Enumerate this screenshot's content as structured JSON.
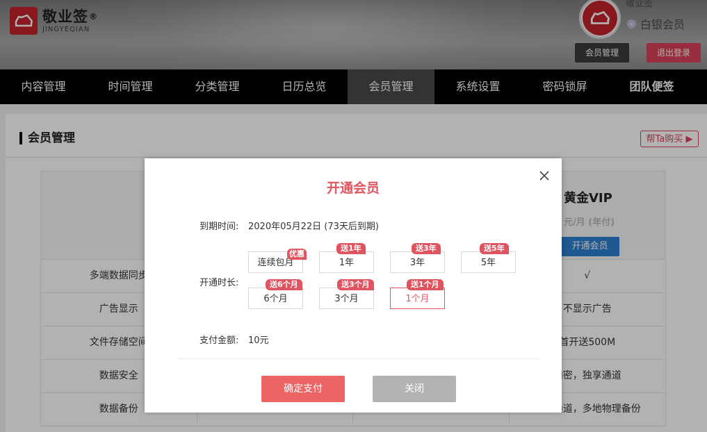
{
  "header": {
    "logo_title": "敬业签",
    "logo_registered": "®",
    "logo_subtitle": "JINGYEQIAN",
    "user_name": "敬业签",
    "member_level": "白银会员",
    "level_icon_text": "v",
    "member_manage_button": "会员管理",
    "logout_button": "退出登录",
    "colors": {
      "brand_red": "#c5212c",
      "logout_pink": "#d9415a"
    }
  },
  "nav": {
    "items": [
      {
        "label": "内容管理"
      },
      {
        "label": "时间管理"
      },
      {
        "label": "分类管理"
      },
      {
        "label": "日历总览"
      },
      {
        "label": "会员管理",
        "active": true
      },
      {
        "label": "系统设置"
      },
      {
        "label": "密码锁屏"
      },
      {
        "label": "团队便签"
      }
    ]
  },
  "page": {
    "section_title": "会员管理",
    "help_buy": "帮Ta购买",
    "plan": {
      "title": "黄金VIP",
      "price": "元/月 (年付)",
      "button": "开通会员"
    },
    "rows": [
      {
        "feature": "多端数据同步",
        "col2": "",
        "col3": "",
        "col4": "√"
      },
      {
        "feature": "广告显示",
        "col2": "",
        "col3": "",
        "col4": "不显示广告"
      },
      {
        "feature": "文件存储空间",
        "col2": "",
        "col3": "",
        "col4": "首开送500M"
      },
      {
        "feature": "数据安全",
        "col2": "",
        "col3": "",
        "col4": "加密，独享通道"
      },
      {
        "feature": "数据备份",
        "col2": "",
        "col3": "",
        "col4": "独享通道，多地物理备份"
      }
    ]
  },
  "modal": {
    "title": "开通会员",
    "close_icon": "close-icon",
    "expiry_label": "到期时间:",
    "expiry_value": "2020年05月22日 (73天后到期)",
    "duration_label": "开通时长:",
    "options": [
      {
        "label": "连续包月",
        "badge": "优惠"
      },
      {
        "label": "1年",
        "badge": "送1年"
      },
      {
        "label": "3年",
        "badge": "送3年"
      },
      {
        "label": "5年",
        "badge": "送5年"
      },
      {
        "label": "6个月",
        "badge": "送6个月"
      },
      {
        "label": "3个月",
        "badge": "送3个月"
      },
      {
        "label": "1个月",
        "badge": "送1个月",
        "selected": true
      }
    ],
    "pay_label": "支付金额:",
    "pay_value": "10元",
    "confirm_button": "确定支付",
    "close_button": "关闭",
    "colors": {
      "accent": "#e0545f",
      "confirm": "#ec6464",
      "close": "#b3b3b3"
    }
  }
}
